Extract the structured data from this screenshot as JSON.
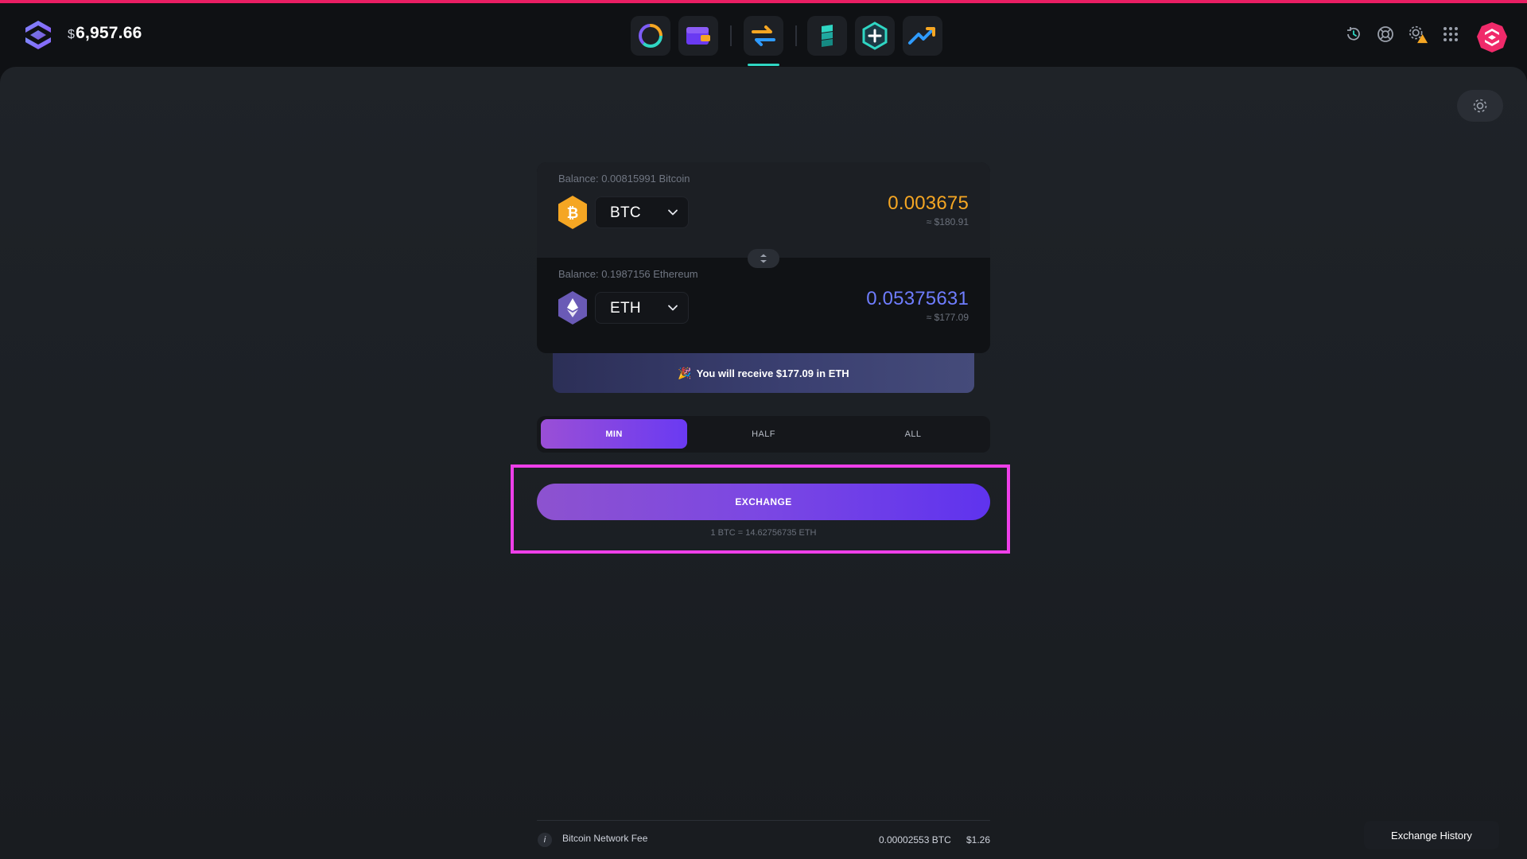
{
  "header": {
    "currency_symbol": "$",
    "total_balance": "6,957.66",
    "nav_items": [
      {
        "name": "portfolio-icon"
      },
      {
        "name": "wallet-icon"
      },
      {
        "name": "exchange-icon",
        "active": true
      },
      {
        "name": "staking-icon"
      },
      {
        "name": "add-app-icon"
      },
      {
        "name": "trending-icon"
      }
    ],
    "tools": [
      "history-icon",
      "support-icon",
      "settings-warning-icon",
      "apps-grid-icon"
    ]
  },
  "exchange": {
    "from": {
      "balance_label": "Balance: 0.00815991 Bitcoin",
      "ticker": "BTC",
      "amount": "0.003675",
      "usd": "≈ $180.91",
      "amount_color": "#f5a623"
    },
    "to": {
      "balance_label": "Balance: 0.1987156 Ethereum",
      "ticker": "ETH",
      "amount": "0.05375631",
      "usd": "≈ $177.09",
      "amount_color": "#6f7dff"
    },
    "receive_emoji": "🎉",
    "receive_text": "You will receive $177.09 in ETH",
    "amount_options": {
      "min": "MIN",
      "half": "HALF",
      "all": "ALL",
      "selected": "MIN"
    },
    "exchange_label": "EXCHANGE",
    "rate": "1 BTC = 14.62756735 ETH"
  },
  "fee": {
    "info_glyph": "i",
    "label": "Bitcoin Network Fee",
    "btc": "0.00002553 BTC",
    "usd": "$1.26"
  },
  "footer": {
    "history_label": "Exchange History"
  }
}
